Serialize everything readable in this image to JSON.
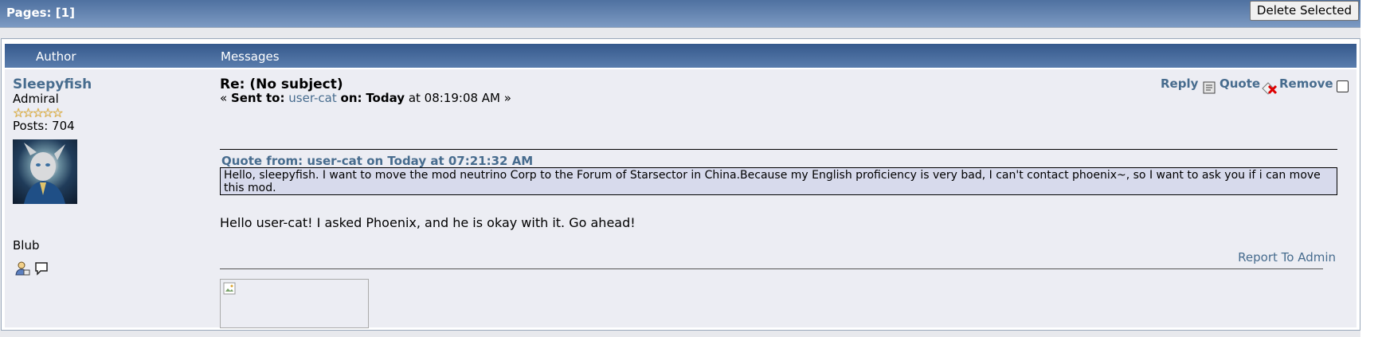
{
  "pagination": {
    "label": "Pages: [1]"
  },
  "toolbar": {
    "delete_selected_label": "Delete Selected"
  },
  "table_header": {
    "author": "Author",
    "messages": "Messages"
  },
  "post": {
    "author": {
      "name": "Sleepyfish",
      "rank": "Admiral",
      "stars": "☆☆☆☆☆",
      "posts": "Posts: 704",
      "personal_text": "Blub",
      "avatar_icon": "avatar-image",
      "profile_icon": "profile-icon",
      "pm_icon": "speech-bubble-icon"
    },
    "subject": "Re: (No subject)",
    "sent": {
      "prefix": "« ",
      "sent_to_label": "Sent to:",
      "recipient": "user-cat",
      "on_label": "on:",
      "date_bold": "Today",
      "time": " at 08:19:08 AM »"
    },
    "actions": {
      "reply": "Reply",
      "quote": "Quote",
      "remove": "Remove"
    },
    "quote": {
      "header": "Quote from: user-cat on Today at 07:21:32 AM",
      "text": "Hello, sleepyfish. I want to move the mod neutrino Corp to the  Forum of Starsector in China.Because my English  proficiency is very bad, I can't contact phoenix~, so I want to ask you if i can move this mod."
    },
    "body": "Hello user-cat! I asked Phoenix, and he is okay with it. Go ahead!",
    "report": "Report To Admin"
  }
}
